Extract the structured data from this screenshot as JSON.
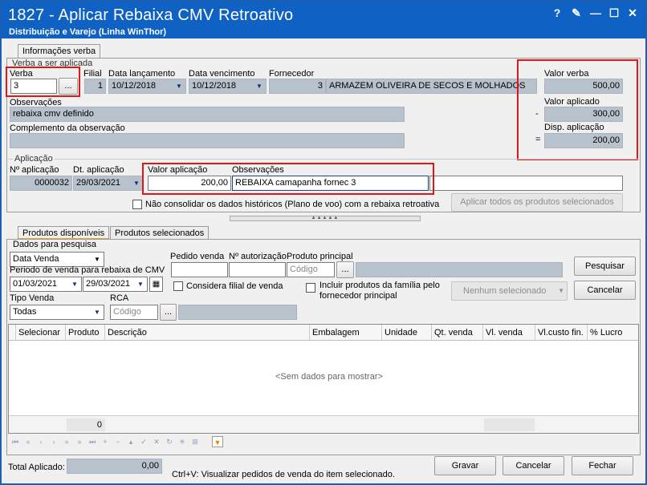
{
  "window": {
    "title": "1827 - Aplicar Rebaixa CMV Retroativo",
    "subtitle": "Distribuição e Varejo (Linha WinThor)",
    "btn_help": "?",
    "btn_edit": "✎",
    "btn_min": "—",
    "btn_max": "☐",
    "btn_close": "✕"
  },
  "tab_info": "Informações verba",
  "verba": {
    "group": "Verba a ser aplicada",
    "verba_label": "Verba",
    "verba_value": "3",
    "ellipsis": "...",
    "filial_label": "Filial",
    "filial_value": "1",
    "dt_lanc_label": "Data lançamento",
    "dt_lanc_value": "10/12/2018",
    "dt_venc_label": "Data vencimento",
    "dt_venc_value": "10/12/2018",
    "fornecedor_label": "Fornecedor",
    "fornecedor_code": "3",
    "fornecedor_name": "ARMAZEM OLIVEIRA DE SECOS E MOLHADOS",
    "obs_label": "Observações",
    "obs_value": "rebaixa cmv definido",
    "compl_label": "Complemento da observação",
    "compl_value": "",
    "valor_verba_label": "Valor verba",
    "valor_verba": "500,00",
    "valor_aplicado_label": "Valor aplicado",
    "valor_aplicado": "300,00",
    "minus": "-",
    "disp_label": "Disp. aplicação",
    "disp_value": "200,00",
    "equals": "="
  },
  "aplicacao": {
    "group": "Aplicação",
    "num_label": "Nº aplicação",
    "num_value": "0000032",
    "dt_label": "Dt. aplicação",
    "dt_value": "29/03/2021",
    "valor_label": "Valor aplicação",
    "valor_value": "200,00",
    "obs_label": "Observações",
    "obs_value": "REBAIXA camapanha fornec 3",
    "chk_label": "Não consolidar os dados históricos (Plano de voo) com a rebaixa retroativa",
    "apply_all": "Aplicar todos os produtos selecionados"
  },
  "tabs": {
    "disponiveis": "Produtos disponíveis",
    "selecionados": "Produtos selecionados"
  },
  "pesquisa": {
    "group": "Dados para pesquisa",
    "tipo_data": "Data Venda",
    "periodo_label": "Periodo de venda para rebaixa de CMV",
    "data_ini": "01/03/2021",
    "data_fim": "29/03/2021",
    "pedido_label": "Pedido venda",
    "autoriz_label": "Nº autorização",
    "produto_label": "Produto principal",
    "produto_placeholder": "Código",
    "considera_label": "Considera filial de venda",
    "incluir_label": "Incluir produtos da família pelo fornecedor principal",
    "tipo_venda_label": "Tipo Venda",
    "tipo_venda_value": "Todas",
    "rca_label": "RCA",
    "rca_placeholder": "Código",
    "pesquisar": "Pesquisar",
    "cancelar": "Cancelar",
    "nenhum": "Nenhum selecionado"
  },
  "grid": {
    "columns": [
      "Selecionar",
      "Produto",
      "Descrição",
      "Embalagem",
      "Unidade",
      "Qt. venda",
      "Vl. venda",
      "Vl.custo fin.",
      "% Lucro"
    ],
    "empty": "<Sem dados para mostrar>",
    "footer_count": "0"
  },
  "footer": {
    "total_label": "Total Aplicado:",
    "total_value": "0,00",
    "hint": "Ctrl+V: Visualizar pedidos de venda do item selecionado.",
    "gravar": "Gravar",
    "cancelar": "Cancelar",
    "fechar": "Fechar"
  },
  "colors": {
    "title_bg": "#0f62c4",
    "highlight": "#e0161b",
    "readonly": "#b8c2cc"
  }
}
